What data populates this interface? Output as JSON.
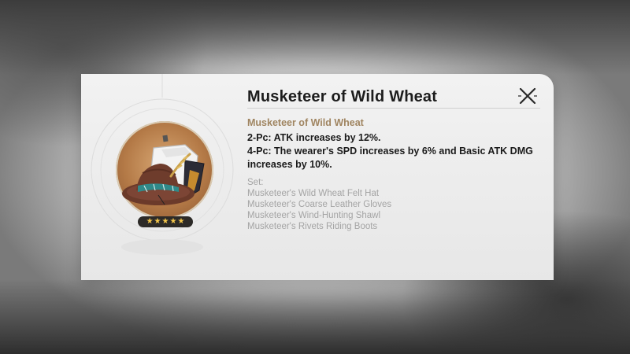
{
  "relic_card": {
    "title": "Musketeer of Wild Wheat",
    "set_name": "Musketeer of Wild Wheat",
    "bonus_2pc": "2-Pc: ATK increases by 12%.",
    "bonus_4pc": "4-Pc: The wearer's SPD increases by 6% and Basic ATK DMG increases by 10%.",
    "set_label": "Set:",
    "pieces": [
      "Musketeer's Wild Wheat Felt Hat",
      "Musketeer's Coarse Leather Gloves",
      "Musketeer's Wind-Hunting Shawl",
      "Musketeer's Rivets Riding Boots"
    ],
    "rarity_stars": [
      "★",
      "★",
      "★",
      "★",
      "★"
    ],
    "icon": "felt-hat-relic-icon",
    "close_icon": "close-icon"
  },
  "colors": {
    "set_name": "#a08561",
    "star": "#f4c64a",
    "muted_text": "#a4a4a4"
  }
}
